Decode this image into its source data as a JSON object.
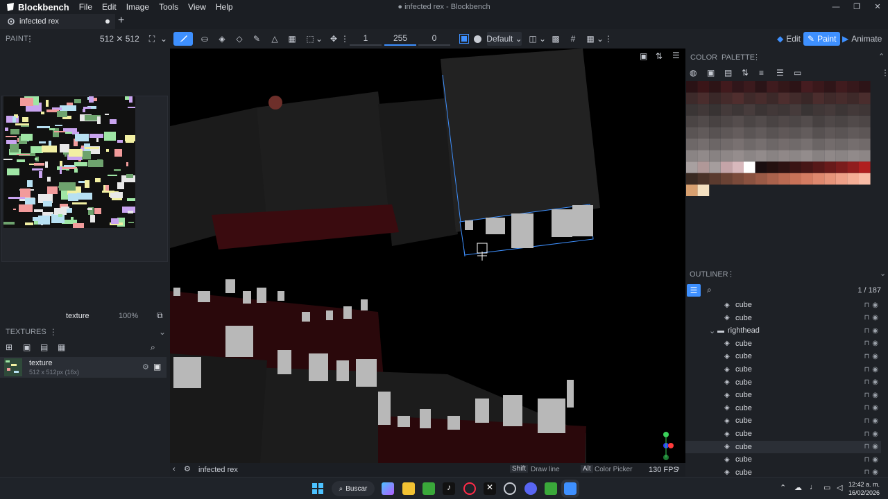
{
  "app": {
    "name": "Blockbench",
    "window_title": "● infected rex - Blockbench"
  },
  "menu": [
    "File",
    "Edit",
    "Image",
    "Tools",
    "View",
    "Help"
  ],
  "window_controls": {
    "minimize": "—",
    "maximize": "❐",
    "close": "✕"
  },
  "tab": {
    "label": "infected rex",
    "add": "+"
  },
  "toolbar": {
    "size_value": "1",
    "opacity_value": "255",
    "softness_value": "0",
    "blend_mode": "Default"
  },
  "modes": {
    "edit": "Edit",
    "paint": "Paint",
    "animate": "Animate"
  },
  "paint_panel": {
    "header": "PAINT",
    "resolution": "512 ✕ 512",
    "texture_name": "texture",
    "zoom": "100%"
  },
  "textures_panel": {
    "header": "TEXTURES",
    "item_name": "texture",
    "item_meta": "512 x 512px (16x)"
  },
  "viewport": {
    "bottom_label": "infected rex",
    "shift_key": "Shift",
    "shift_hint": "Draw line",
    "alt_key": "Alt",
    "alt_hint": "Color Picker",
    "fps": "130 FPS"
  },
  "color_panel": {
    "tab_color": "COLOR",
    "tab_palette": "PALETTE"
  },
  "outliner": {
    "header": "OUTLINER",
    "count": "1 / 187",
    "rows": [
      {
        "label": "cube",
        "type": "cube",
        "indent": 1
      },
      {
        "label": "cube",
        "type": "cube",
        "indent": 1
      },
      {
        "label": "righthead",
        "type": "folder",
        "indent": 0
      },
      {
        "label": "cube",
        "type": "cube",
        "indent": 1
      },
      {
        "label": "cube",
        "type": "cube",
        "indent": 1
      },
      {
        "label": "cube",
        "type": "cube",
        "indent": 1
      },
      {
        "label": "cube",
        "type": "cube",
        "indent": 1
      },
      {
        "label": "cube",
        "type": "cube",
        "indent": 1
      },
      {
        "label": "cube",
        "type": "cube",
        "indent": 1
      },
      {
        "label": "cube",
        "type": "cube",
        "indent": 1
      },
      {
        "label": "cube",
        "type": "cube",
        "indent": 1
      },
      {
        "label": "cube",
        "type": "cube",
        "indent": 1,
        "selected": true
      },
      {
        "label": "cube",
        "type": "cube",
        "indent": 1
      },
      {
        "label": "cube",
        "type": "cube",
        "indent": 1
      }
    ]
  },
  "taskbar": {
    "search_label": "Buscar",
    "time": "12:42 a. m.",
    "date": "16/02/2026"
  },
  "colors": {
    "accent": "#3e90ff",
    "panel": "#1e2126",
    "viewport": "#000000",
    "tooth": "#b8b8b8"
  }
}
